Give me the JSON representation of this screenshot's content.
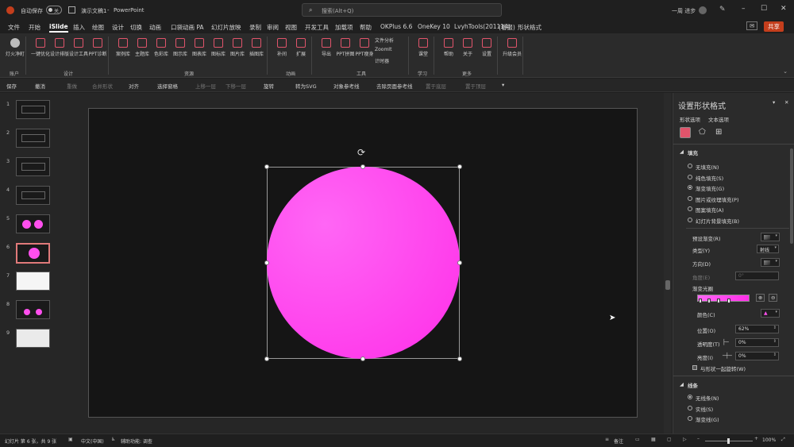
{
  "titlebar": {
    "autosave_label": "自动保存",
    "autosave_state": "关",
    "doc_title": "演示文稿1",
    "separator": "-",
    "app_name": "PowerPoint",
    "search_placeholder": "搜索(Alt+Q)",
    "user_name": "一周 进步",
    "brand_color": "#c43e1c"
  },
  "tabs": [
    "文件",
    "开始",
    "iSlide",
    "插入",
    "绘图",
    "设计",
    "切换",
    "动画",
    "口袋动画 PA",
    "幻灯片放映",
    "录制",
    "审阅",
    "视图",
    "开发工具",
    "加载项",
    "帮助",
    "OKPlus 6.6",
    "OneKey 10",
    "LvyhTools(201114)",
    "形状格式"
  ],
  "tabs_extra": "(看报)",
  "active_tab": "iSlide",
  "share_label": "共享",
  "ribbon": {
    "groups": [
      {
        "label": "账户",
        "buttons": [
          "灯火净町"
        ]
      },
      {
        "label": "设计",
        "buttons": [
          "一键优化",
          "设计排版",
          "设计工具",
          "PPT诊断"
        ]
      },
      {
        "label": "资源",
        "buttons": [
          "案例库",
          "主题库",
          "色彩库",
          "图示库",
          "图表库",
          "图标库",
          "图片库",
          "插图库"
        ]
      },
      {
        "label": "动画",
        "buttons": [
          "补间",
          "扩展"
        ]
      },
      {
        "label": "工具",
        "buttons": [
          "导出",
          "PPT拼图",
          "PPT瘦身"
        ],
        "small": [
          "文件分析",
          "ZoomIt",
          "计时器"
        ]
      },
      {
        "label": "学习",
        "buttons": [
          "课堂"
        ]
      },
      {
        "label": "更多",
        "buttons": [
          "帮助",
          "关于",
          "设置"
        ]
      },
      {
        "label": "",
        "buttons": [
          "升级会员"
        ]
      }
    ]
  },
  "qat": {
    "items": [
      "保存",
      "撤消",
      "重做",
      "合并形状",
      "对齐",
      "选择窗格",
      "上移一层",
      "下移一层",
      "旋转",
      "转为SVG",
      "对象参考线",
      "去除页面参考线",
      "置于底层",
      "置于顶层"
    ]
  },
  "slides": {
    "numbers": [
      "1",
      "2",
      "3",
      "4",
      "5",
      "6",
      "7",
      "8",
      "9"
    ],
    "active": 6
  },
  "shape": {
    "fill_color_light": "#ff66f5",
    "fill_color_dark": "#ff2ee8",
    "slide_bg": "#151515"
  },
  "pane": {
    "title": "设置形状格式",
    "tab_shape": "形状选项",
    "tab_text": "文本选项",
    "section_fill": "填充",
    "fill_options": [
      "无填充(N)",
      "纯色填充(S)",
      "渐变填充(G)",
      "图片或纹理填充(P)",
      "图案填充(A)",
      "幻灯片背景填充(B)"
    ],
    "fill_selected": 2,
    "preset_label": "预设渐变(R)",
    "type_label": "类型(Y)",
    "type_value": "射线",
    "direction_label": "方向(D)",
    "angle_label": "角度(E)",
    "angle_value": "0°",
    "stops_label": "渐变光圈",
    "color_label": "颜色(C)",
    "position_label": "位置(O)",
    "position_value": "62%",
    "transparency_label": "透明度(T)",
    "transparency_value": "0%",
    "brightness_label": "亮度(I)",
    "brightness_value": "0%",
    "rotate_label": "与形状一起旋转(W)",
    "section_line": "线条",
    "line_options": [
      "无线条(N)",
      "实线(S)",
      "渐变线(G)"
    ],
    "line_selected": 0
  },
  "status": {
    "slide_info": "幻灯片 第 6 张，共 9 张",
    "language": "中文(中国)",
    "accessibility": "辅助功能: 调查",
    "notes": "备注",
    "zoom": "100%"
  }
}
